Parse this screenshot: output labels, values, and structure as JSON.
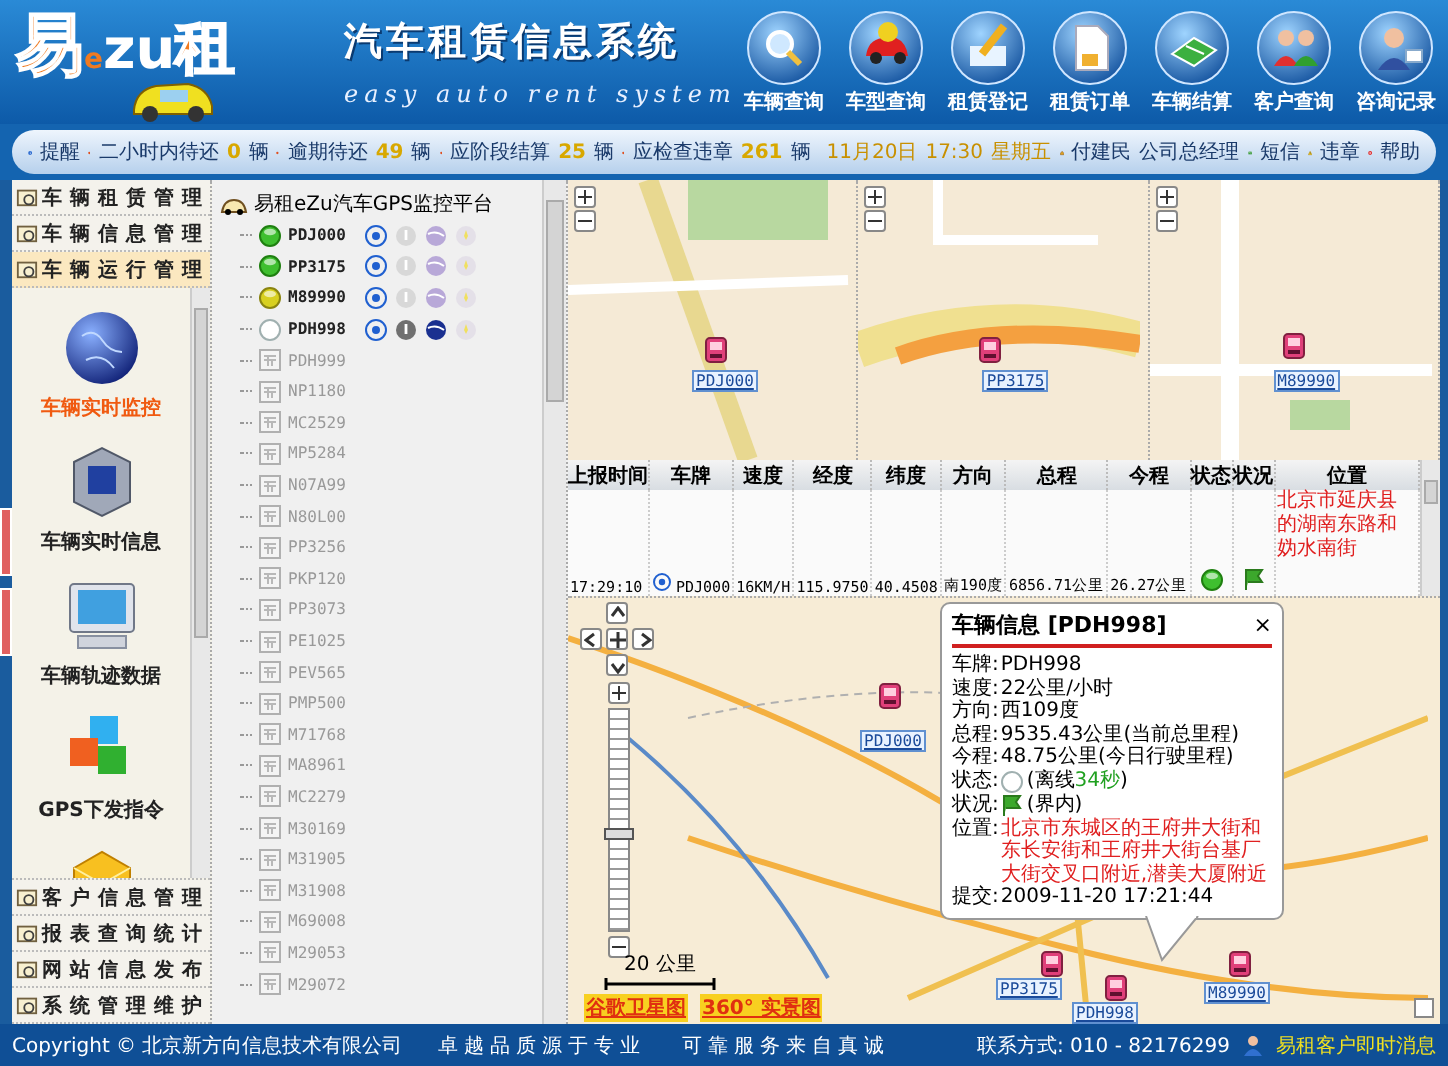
{
  "header": {
    "logo_text": [
      "易",
      "e",
      "zu",
      "租"
    ],
    "title": "汽车租赁信息系统",
    "subtitle": "easy auto rent system",
    "buttons": [
      {
        "label": "车辆查询"
      },
      {
        "label": "车型查询"
      },
      {
        "label": "租赁登记"
      },
      {
        "label": "租赁订单"
      },
      {
        "label": "车辆结算"
      },
      {
        "label": "客户查询"
      },
      {
        "label": "咨询记录"
      }
    ]
  },
  "info_bar": {
    "label": "提醒",
    "reminders": [
      {
        "text": "二小时内待还",
        "count": "0",
        "unit": "辆"
      },
      {
        "text": "逾期待还",
        "count": "49",
        "unit": "辆"
      },
      {
        "text": "应阶段结算",
        "count": "25",
        "unit": "辆"
      },
      {
        "text": "应检查违章",
        "count": "261",
        "unit": "辆"
      }
    ],
    "date": "11月20日",
    "time": "17:30",
    "weekday": "星期五",
    "user": "付建民",
    "role": "公司总经理",
    "links": [
      {
        "label": "短信"
      },
      {
        "label": "违章"
      },
      {
        "label": "帮助"
      }
    ]
  },
  "menu": {
    "sections": [
      {
        "label": "车辆租赁管理",
        "expanded": false
      },
      {
        "label": "车辆信息管理",
        "expanded": false
      },
      {
        "label": "车辆运行管理",
        "expanded": true,
        "items": [
          {
            "label": "车辆实时监控",
            "selected": true
          },
          {
            "label": "车辆实时信息",
            "selected": false
          },
          {
            "label": "车辆轨迹数据",
            "selected": false
          },
          {
            "label": "GPS下发指令",
            "selected": false
          },
          {
            "selected": false
          }
        ]
      },
      {
        "label": "客户信息管理",
        "expanded": false
      },
      {
        "label": "报表查询统计",
        "expanded": false
      },
      {
        "label": "网站信息发布",
        "expanded": false
      },
      {
        "label": "系统管理维护",
        "expanded": false
      }
    ]
  },
  "tree": {
    "root": "易租eZu汽车GPS监控平台",
    "vehicles": [
      {
        "plate": "PDJ000",
        "kind": "online"
      },
      {
        "plate": "PP3175",
        "kind": "online"
      },
      {
        "plate": "M89990",
        "kind": "idle"
      },
      {
        "plate": "PDH998",
        "kind": "offline"
      },
      {
        "plate": "PDH999",
        "kind": "inactive"
      },
      {
        "plate": "NP1180",
        "kind": "inactive"
      },
      {
        "plate": "MC2529",
        "kind": "inactive"
      },
      {
        "plate": "MP5284",
        "kind": "inactive"
      },
      {
        "plate": "N07A99",
        "kind": "inactive"
      },
      {
        "plate": "N80L00",
        "kind": "inactive"
      },
      {
        "plate": "PP3256",
        "kind": "inactive"
      },
      {
        "plate": "PKP120",
        "kind": "inactive"
      },
      {
        "plate": "PP3073",
        "kind": "inactive"
      },
      {
        "plate": "PE1025",
        "kind": "inactive"
      },
      {
        "plate": "PEV565",
        "kind": "inactive"
      },
      {
        "plate": "PMP500",
        "kind": "inactive"
      },
      {
        "plate": "M71768",
        "kind": "inactive"
      },
      {
        "plate": "MA8961",
        "kind": "inactive"
      },
      {
        "plate": "MC2279",
        "kind": "inactive"
      },
      {
        "plate": "M30169",
        "kind": "inactive"
      },
      {
        "plate": "M31905",
        "kind": "inactive"
      },
      {
        "plate": "M31908",
        "kind": "inactive"
      },
      {
        "plate": "M69008",
        "kind": "inactive"
      },
      {
        "plate": "M29053",
        "kind": "inactive"
      },
      {
        "plate": "M29072",
        "kind": "inactive"
      }
    ]
  },
  "top_map": {
    "panes": [
      {
        "markers": [
          {
            "plate": "PDJ000"
          }
        ]
      },
      {
        "markers": [
          {
            "plate": "PP3175"
          }
        ]
      },
      {
        "markers": [
          {
            "plate": "M89990"
          }
        ]
      }
    ]
  },
  "table": {
    "columns": [
      "上报时间",
      "车牌",
      "速度",
      "经度",
      "纬度",
      "方向",
      "总程",
      "今程",
      "状态",
      "状况",
      "位置"
    ],
    "rows": [
      {
        "cells": [
          {
            "kind": "text",
            "text": "17:29:10"
          },
          {
            "kind": "plate",
            "text": "PDJ000"
          },
          {
            "kind": "text",
            "text": "16KM/H"
          },
          {
            "kind": "text",
            "text": "115.9750"
          },
          {
            "kind": "text",
            "text": "40.4508"
          },
          {
            "kind": "text",
            "text": "南190度"
          },
          {
            "kind": "text",
            "text": "6856.71公里"
          },
          {
            "kind": "text",
            "text": "26.27公里"
          },
          {
            "kind": "online_status"
          },
          {
            "kind": "flag"
          },
          {
            "kind": "location",
            "text": "北京市延庆县的湖南东路和妫水南街"
          }
        ]
      }
    ]
  },
  "bottom_map": {
    "markers": [
      {
        "plate": "PDJ000"
      },
      {
        "plate": "PP3175"
      },
      {
        "plate": "PDH998"
      },
      {
        "plate": "M89990"
      }
    ],
    "zoom_slider": {
      "level": 0.44
    },
    "scale": "20 公里",
    "buttons": [
      {
        "label": "谷歌卫星图"
      },
      {
        "label": "360° 实景图"
      }
    ],
    "popup": {
      "title": "车辆信息",
      "plate": "[PDH998]",
      "close": "×",
      "fields": [
        {
          "kind": "text",
          "label": "车牌:",
          "value": "PDH998"
        },
        {
          "kind": "text",
          "label": "速度:",
          "value": "22公里/小时"
        },
        {
          "kind": "text",
          "label": "方向:",
          "value": "西109度"
        },
        {
          "kind": "text",
          "label": "总程:",
          "value": "9535.43公里(当前总里程)"
        },
        {
          "kind": "text",
          "label": "今程:",
          "value": "48.75公里(今日行驶里程)"
        },
        {
          "kind": "offline_status",
          "label": "状态:",
          "value": "(离线",
          "extra": "34秒",
          "tail": ")"
        },
        {
          "kind": "flag",
          "label": "状况:",
          "value": "(界内)"
        },
        {
          "kind": "alert",
          "label": "位置:",
          "value": "北京市东城区的王府井大街和东长安街和王府井大街台基厂大街交叉口附近,潜美大厦附近"
        },
        {
          "kind": "text",
          "label": "提交:",
          "value": "2009-11-20 17:21:44"
        }
      ]
    }
  },
  "footer": {
    "copyright": "Copyright © 北京新方向信息技术有限公司",
    "slogan_1": "卓越品质源于专业",
    "slogan_2": "可靠服务来自真诚",
    "contact": "联系方式: 010 - 82176299",
    "messenger": "易租客户即时消息"
  }
}
